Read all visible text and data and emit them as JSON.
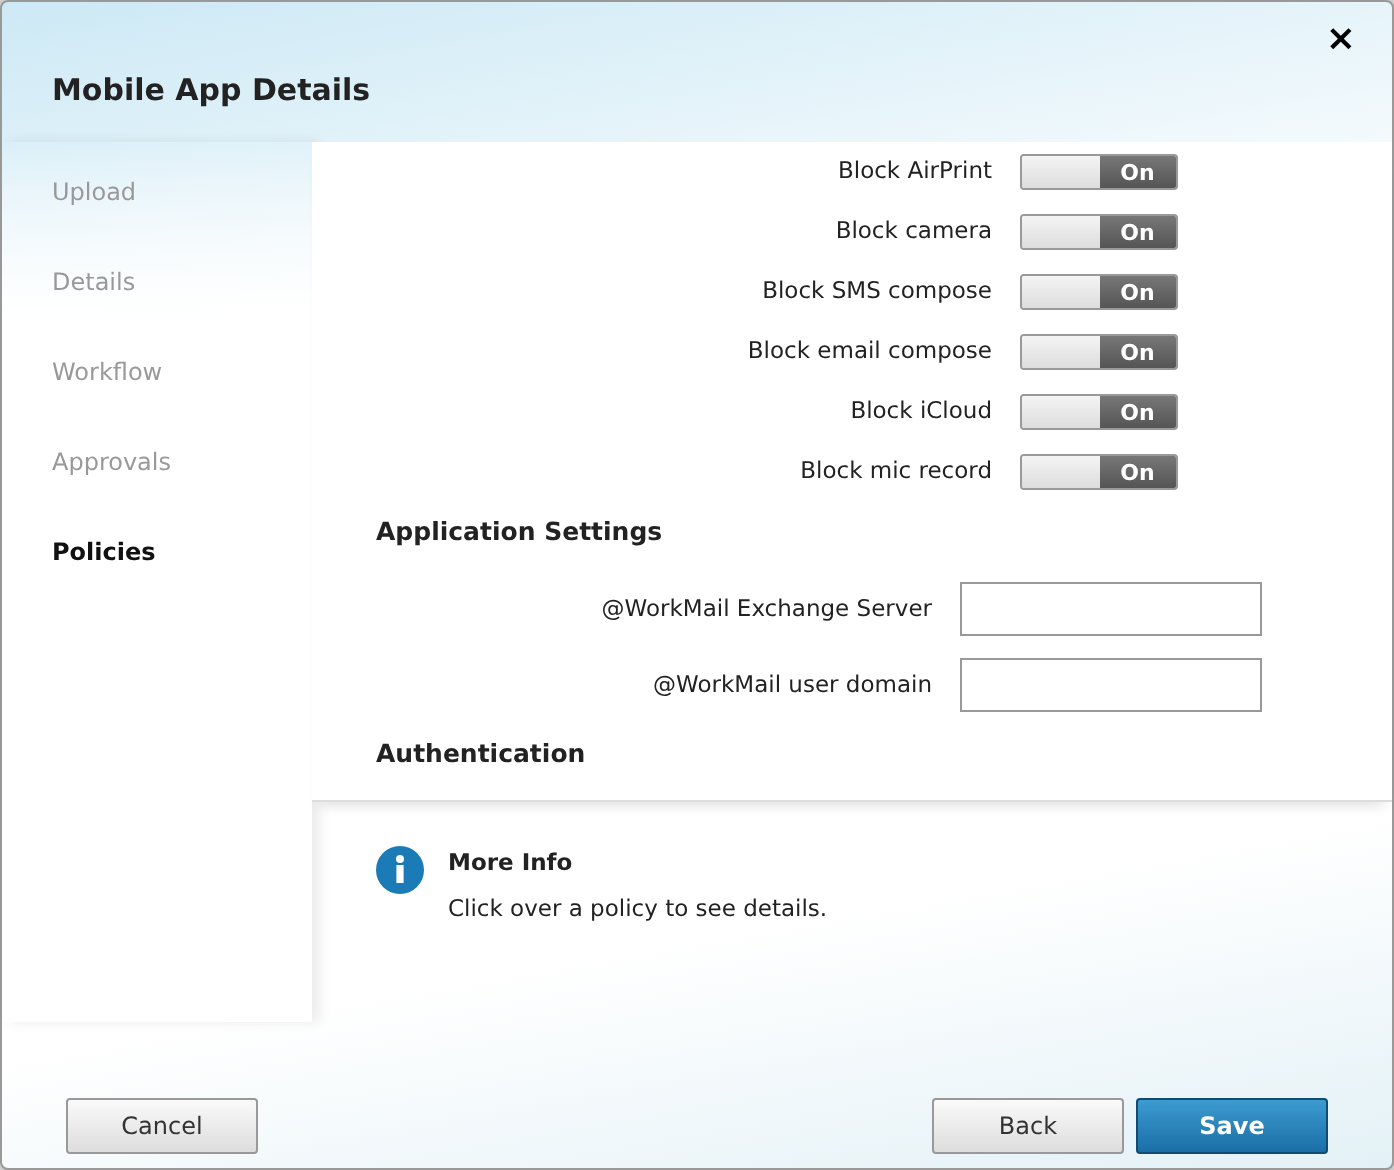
{
  "window": {
    "title": "Mobile App Details",
    "close": "×"
  },
  "steps": [
    {
      "label": "Upload",
      "selected": false
    },
    {
      "label": "Details",
      "selected": false
    },
    {
      "label": "Workflow",
      "selected": false
    },
    {
      "label": "Approvals",
      "selected": false
    },
    {
      "label": "Policies",
      "selected": true
    }
  ],
  "sections": [
    {
      "kind": "toggles",
      "items": [
        {
          "label": "Block AirPrint",
          "on": true,
          "text": "On"
        },
        {
          "label": "Block camera",
          "on": true,
          "text": "On"
        },
        {
          "label": "Block SMS compose",
          "on": true,
          "text": "On"
        },
        {
          "label": "Block email compose",
          "on": true,
          "text": "On"
        },
        {
          "label": "Block iCloud",
          "on": true,
          "text": "On"
        },
        {
          "label": "Block mic record",
          "on": true,
          "text": "On"
        }
      ]
    },
    {
      "kind": "fields",
      "title": "Application Settings",
      "items": [
        {
          "label": "@WorkMail Exchange Server"
        },
        {
          "label": "@WorkMail user domain"
        }
      ]
    },
    {
      "kind": "heading",
      "title": "Authentication"
    }
  ],
  "info": {
    "title": "More Info",
    "text": "Click over a policy to see details."
  },
  "buttons": [
    {
      "label": "Cancel",
      "kind": "secondary"
    },
    {
      "label": "Back",
      "kind": "secondary"
    },
    {
      "label": "Save",
      "kind": "primary"
    }
  ]
}
